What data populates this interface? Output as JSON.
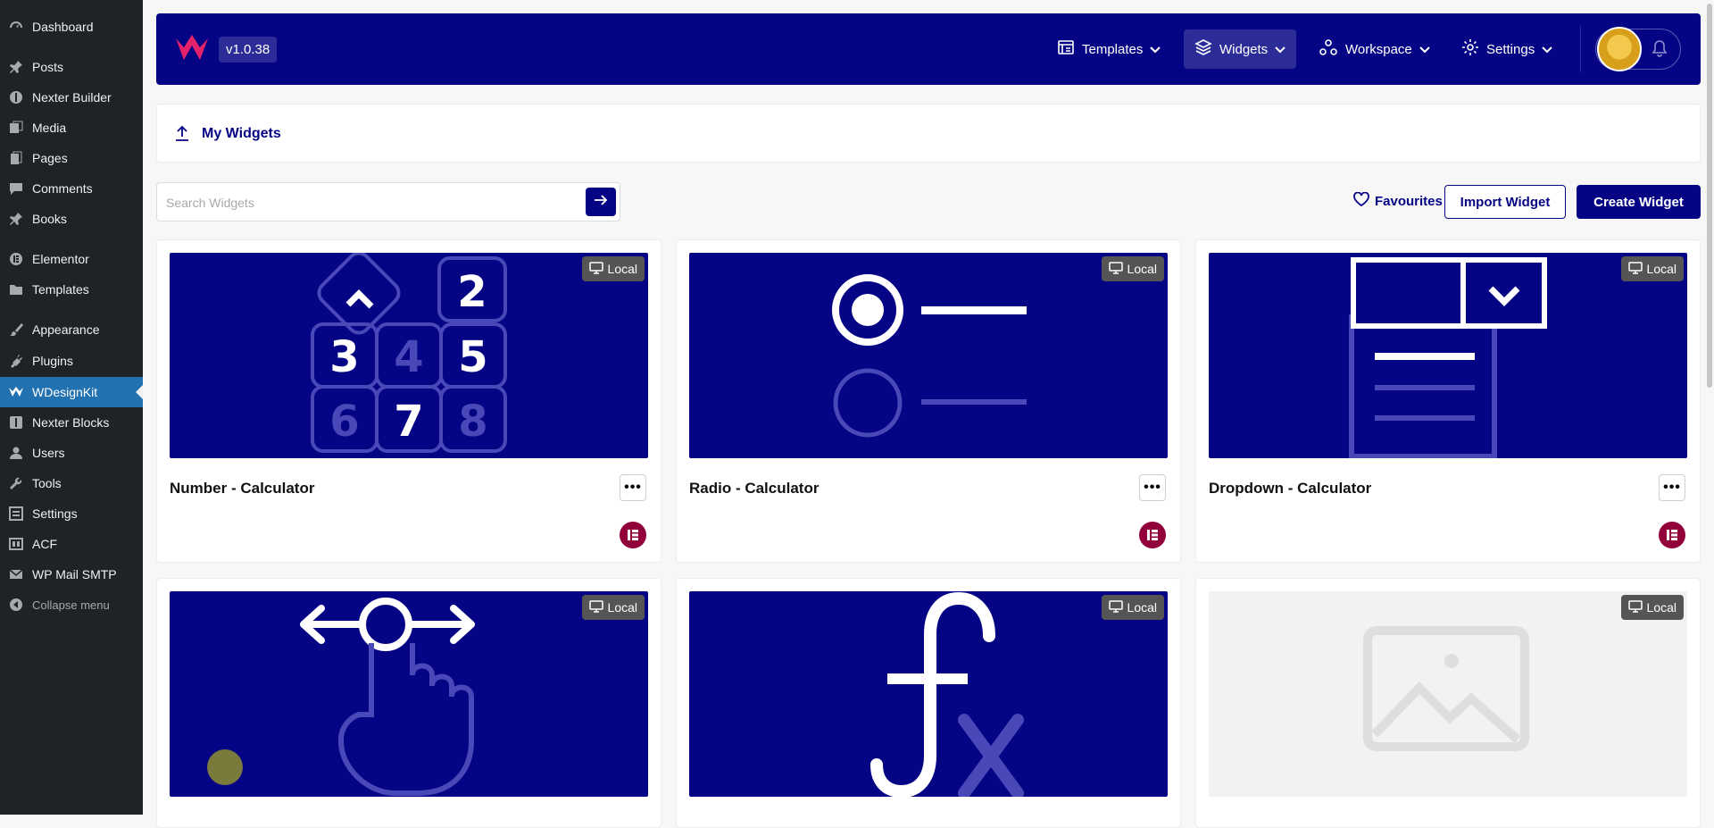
{
  "sidebar": {
    "items": [
      {
        "label": "Dashboard",
        "icon": "dashboard-icon"
      },
      {
        "label": "Posts",
        "icon": "pin-icon"
      },
      {
        "label": "Nexter Builder",
        "icon": "nexter-icon"
      },
      {
        "label": "Media",
        "icon": "media-icon"
      },
      {
        "label": "Pages",
        "icon": "pages-icon"
      },
      {
        "label": "Comments",
        "icon": "comments-icon"
      },
      {
        "label": "Books",
        "icon": "pin-icon"
      },
      {
        "label": "Elementor",
        "icon": "elementor-icon"
      },
      {
        "label": "Templates",
        "icon": "folder-icon"
      },
      {
        "label": "Appearance",
        "icon": "brush-icon"
      },
      {
        "label": "Plugins",
        "icon": "plugin-icon"
      },
      {
        "label": "WDesignKit",
        "icon": "wdesignkit-icon",
        "active": true
      },
      {
        "label": "Nexter Blocks",
        "icon": "nexter-icon"
      },
      {
        "label": "Users",
        "icon": "users-icon"
      },
      {
        "label": "Tools",
        "icon": "wrench-icon"
      },
      {
        "label": "Settings",
        "icon": "settings-icon"
      },
      {
        "label": "ACF",
        "icon": "acf-icon"
      },
      {
        "label": "WP Mail SMTP",
        "icon": "mail-icon"
      },
      {
        "label": "Collapse menu",
        "icon": "collapse-icon"
      }
    ]
  },
  "topbar": {
    "version": "v1.0.38",
    "nav": [
      {
        "label": "Templates",
        "icon": "templates-icon"
      },
      {
        "label": "Widgets",
        "icon": "layers-icon",
        "active": true
      },
      {
        "label": "Workspace",
        "icon": "workspace-icon"
      },
      {
        "label": "Settings",
        "icon": "gear-icon"
      }
    ]
  },
  "breadcrumb": {
    "title": "My Widgets"
  },
  "search": {
    "placeholder": "Search Widgets",
    "value": ""
  },
  "actions": {
    "favourites": "Favourites",
    "import": "Import Widget",
    "create": "Create Widget"
  },
  "widgets": [
    {
      "name": "Number - Calculator",
      "badge": "Local",
      "thumb": "number-keypad"
    },
    {
      "name": "Radio - Calculator",
      "badge": "Local",
      "thumb": "radio"
    },
    {
      "name": "Dropdown - Calculator",
      "badge": "Local",
      "thumb": "dropdown"
    },
    {
      "name": "",
      "badge": "Local",
      "thumb": "slider"
    },
    {
      "name": "",
      "badge": "Local",
      "thumb": "function"
    },
    {
      "name": "",
      "badge": "Local",
      "thumb": "placeholder"
    }
  ],
  "colors": {
    "brand": "#040485",
    "elementor": "#92003b",
    "wp_sidebar": "#1d2327",
    "wp_active": "#2271b1"
  }
}
